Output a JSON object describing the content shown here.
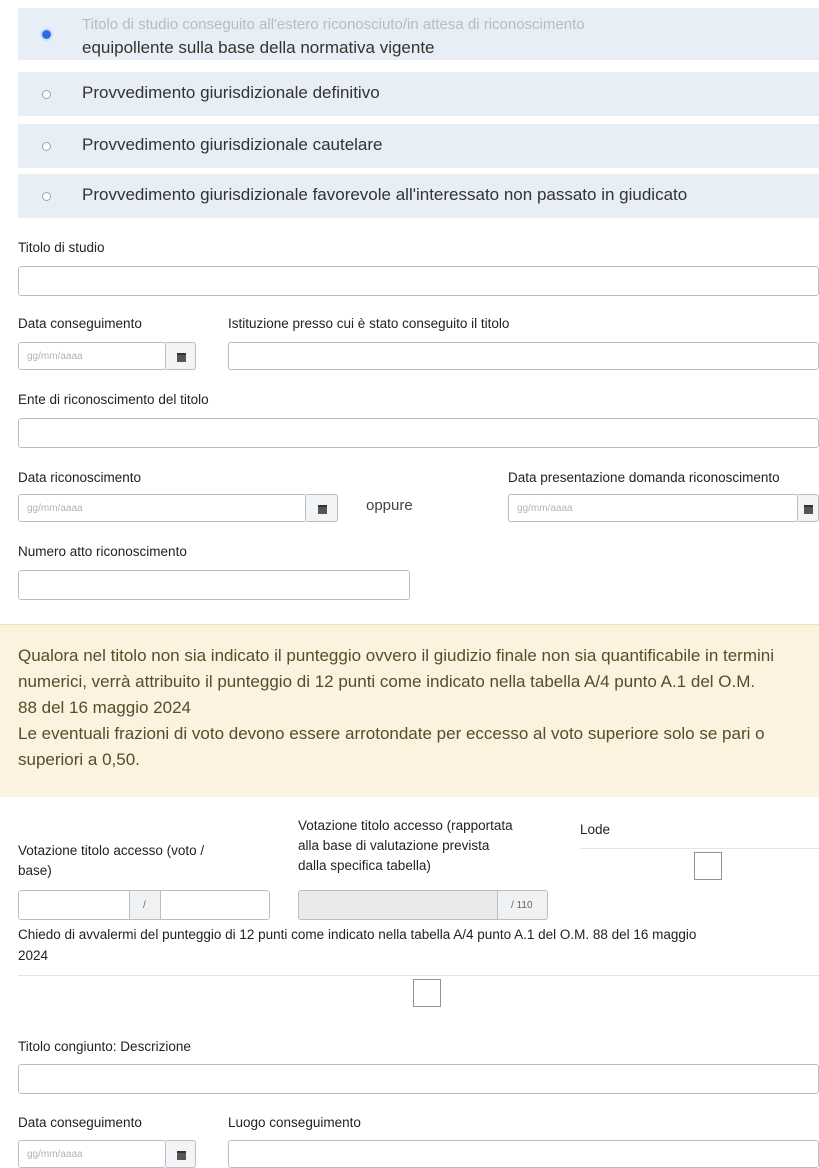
{
  "radio_options": [
    {
      "line1": "Titolo di studio conseguito all'estero riconosciuto/in attesa di riconoscimento",
      "line2": "equipollente sulla base della normativa vigente",
      "selected": true
    },
    {
      "label": "Provvedimento giurisdizionale definitivo",
      "selected": false
    },
    {
      "label": "Provvedimento giurisdizionale cautelare",
      "selected": false
    },
    {
      "label": "Provvedimento giurisdizionale favorevole all'interessato non passato in giudicato",
      "selected": false
    }
  ],
  "form": {
    "titolo_studio_label": "Titolo di studio",
    "data_conseguimento_label": "Data conseguimento",
    "istituzione_label": "Istituzione presso cui è stato conseguito il titolo",
    "date_placeholder": "gg/mm/aaaa",
    "ente_label": "Ente di riconoscimento del titolo",
    "data_riconoscimento_label": "Data riconoscimento",
    "oppure": "oppure",
    "data_presentazione_label": "Data presentazione domanda riconoscimento",
    "numero_atto_label": "Numero atto riconoscimento"
  },
  "notice": {
    "line1": "Qualora nel titolo non sia indicato il punteggio ovvero il giudizio finale non sia quantificabile in termini",
    "line2": "numerici, verrà attribuito il punteggio di 12 punti come indicato nella tabella A/4 punto A.1 del O.M.",
    "line3": "88 del 16 maggio 2024",
    "line4": "Le eventuali frazioni di voto devono essere arrotondate per eccesso al voto superiore solo se pari o",
    "line5": "superiori a 0,50."
  },
  "votazione": {
    "voto_label_line1": "Votazione titolo accesso (voto /",
    "voto_label_line2": "base)",
    "separator": "/",
    "rapportata_line1": "Votazione titolo accesso (rapportata",
    "rapportata_line2": "alla base di valutazione prevista",
    "rapportata_line3": "dalla specifica tabella)",
    "rapportata_suffix": "/ 110",
    "lode_label": "Lode"
  },
  "chiedo": {
    "line1": "Chiedo di avvalermi del punteggio di 12 punti come indicato nella tabella A/4 punto A.1 del O.M. 88 del 16 maggio",
    "line2": "2024"
  },
  "congiunto": {
    "descrizione_label": "Titolo congiunto: Descrizione",
    "data_conseguimento_label": "Data conseguimento",
    "luogo_label": "Luogo conseguimento"
  }
}
